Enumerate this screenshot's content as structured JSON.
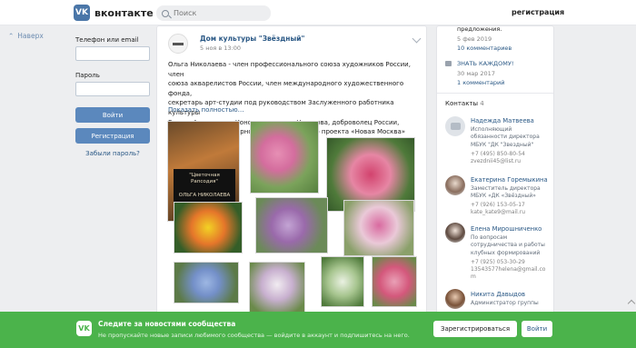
{
  "header": {
    "logo_mark": "VK",
    "logo_text": "вконтакте",
    "search_placeholder": "Поиск",
    "register_link": "регистрация"
  },
  "left": {
    "back_label": "Наверх",
    "phone_label": "Телефон или email",
    "password_label": "Пароль",
    "login_button": "Войти",
    "register_button": "Регистрация",
    "forgot_link": "Забыли пароль?"
  },
  "post": {
    "author": "Дом культуры \"Звёздный\"",
    "date": "5 ноя в 13:00",
    "text_lines": [
      "Ольга Николаева - член профессионального союза художников России, член",
      "союза акварелистов России, член международного художественного фонда,",
      "секретарь арт-студии под руководством Заслуженного работника культуры",
      "России Александра Константиновича Назарова, доброволец России,",
      "руководитель культурно-просветительского проекта «Новая Москва»"
    ],
    "more_link": "Показать полностью…",
    "book_card_lines": [
      "\"Цветочная",
      "Рапсодия\"",
      "ОЛЬГА НИКОЛАЕВА"
    ]
  },
  "sidebar": {
    "topic1_tail": "предложения.",
    "topic1_date": "5 фев 2019",
    "topic1_comments": "10 комментариев",
    "topic2_title": "ЗНАТЬ КАЖДОМУ!",
    "topic2_date": "30 мар 2017",
    "topic2_comments": "1 комментарий",
    "contacts_label": "Контакты",
    "contacts_count": "4",
    "contacts": [
      {
        "name": "Надежда Матвеева",
        "desc": [
          "Исполняющий",
          "обязанности директора",
          "МБУК \"ДК \"Звездный\""
        ],
        "phone": [
          "+7 (495) 850-80-54",
          "zvezdnii45@list.ru"
        ]
      },
      {
        "name": "Екатерина Горемыкина",
        "desc": [
          "Заместитель директора",
          "МБУК «ДК «Звёздный»"
        ],
        "phone": [
          "+7 (926) 153-05-17",
          "kate_kate9@mail.ru"
        ]
      },
      {
        "name": "Елена Мирошниченко",
        "desc": [
          "По вопросам",
          "сотрудничества и работы",
          "клубных формирований"
        ],
        "phone": [
          "+7 (925) 053-30-29",
          "13543577helena@gmail.co",
          "m"
        ]
      },
      {
        "name": "Никита Давыдов",
        "desc": [
          "Администратор группы"
        ],
        "phone": []
      }
    ]
  },
  "bottom_bar": {
    "logo_mark": "VK",
    "title": "Следите за новостями сообщества",
    "subtitle": "Не пропускайте новые записи любимого сообщества — войдите в аккаунт и подпишитесь на него.",
    "register_button": "Зарегистрироваться",
    "login_button": "Войти"
  },
  "colors": {
    "brand": "#4a76a8",
    "link": "#2a5885",
    "green_bar": "#4bb34b",
    "background": "#edeef0"
  }
}
